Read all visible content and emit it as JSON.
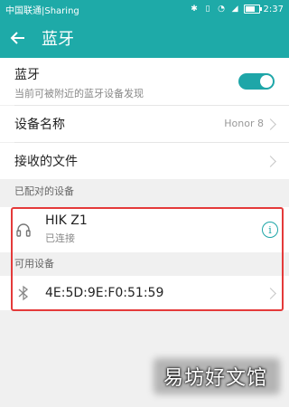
{
  "status_bar": {
    "carrier": "中国联通|Sharing",
    "time": "2:37",
    "battery_level": 0.8
  },
  "header": {
    "title": "蓝牙"
  },
  "bluetooth": {
    "label": "蓝牙",
    "description": "当前可被附近的蓝牙设备发现",
    "enabled": true
  },
  "device_name": {
    "label": "设备名称",
    "value": "Honor 8"
  },
  "received_files": {
    "label": "接收的文件"
  },
  "paired": {
    "section_title": "已配对的设备",
    "devices": [
      {
        "name": "HIK Z1",
        "status": "已连接",
        "icon": "headphones-icon"
      }
    ]
  },
  "available": {
    "section_title": "可用设备",
    "devices": [
      {
        "name": "4E:5D:9E:F0:51:59",
        "icon": "bluetooth-icon"
      }
    ]
  },
  "watermark": {
    "text": "易坊好文馆"
  },
  "colors": {
    "accent": "#1ea6a8",
    "highlight_border": "#e43a3a"
  }
}
